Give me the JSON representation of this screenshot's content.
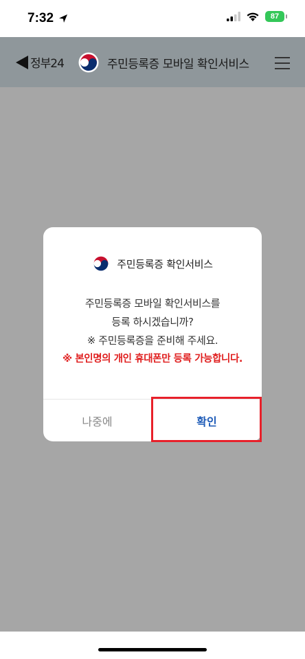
{
  "status_bar": {
    "time": "7:32",
    "battery": "87"
  },
  "header": {
    "back_label": "정부24",
    "title": "주민등록증 모바일 확인서비스"
  },
  "dialog": {
    "title": "주민등록증 확인서비스",
    "lines": [
      "주민등록증 모바일 확인서비스를",
      "등록 하시겠습니까?",
      "※ 주민등록증을 준비해 주세요."
    ],
    "warning": "※ 본인명의 개인 휴대폰만 등록 가능합니다.",
    "later_label": "나중에",
    "confirm_label": "확인"
  },
  "colors": {
    "header_bg": "#8f979b",
    "overlay_bg": "#a6a6a6",
    "warning": "#e02020",
    "confirm": "#1f5cb8",
    "highlight": "#e8202a"
  }
}
